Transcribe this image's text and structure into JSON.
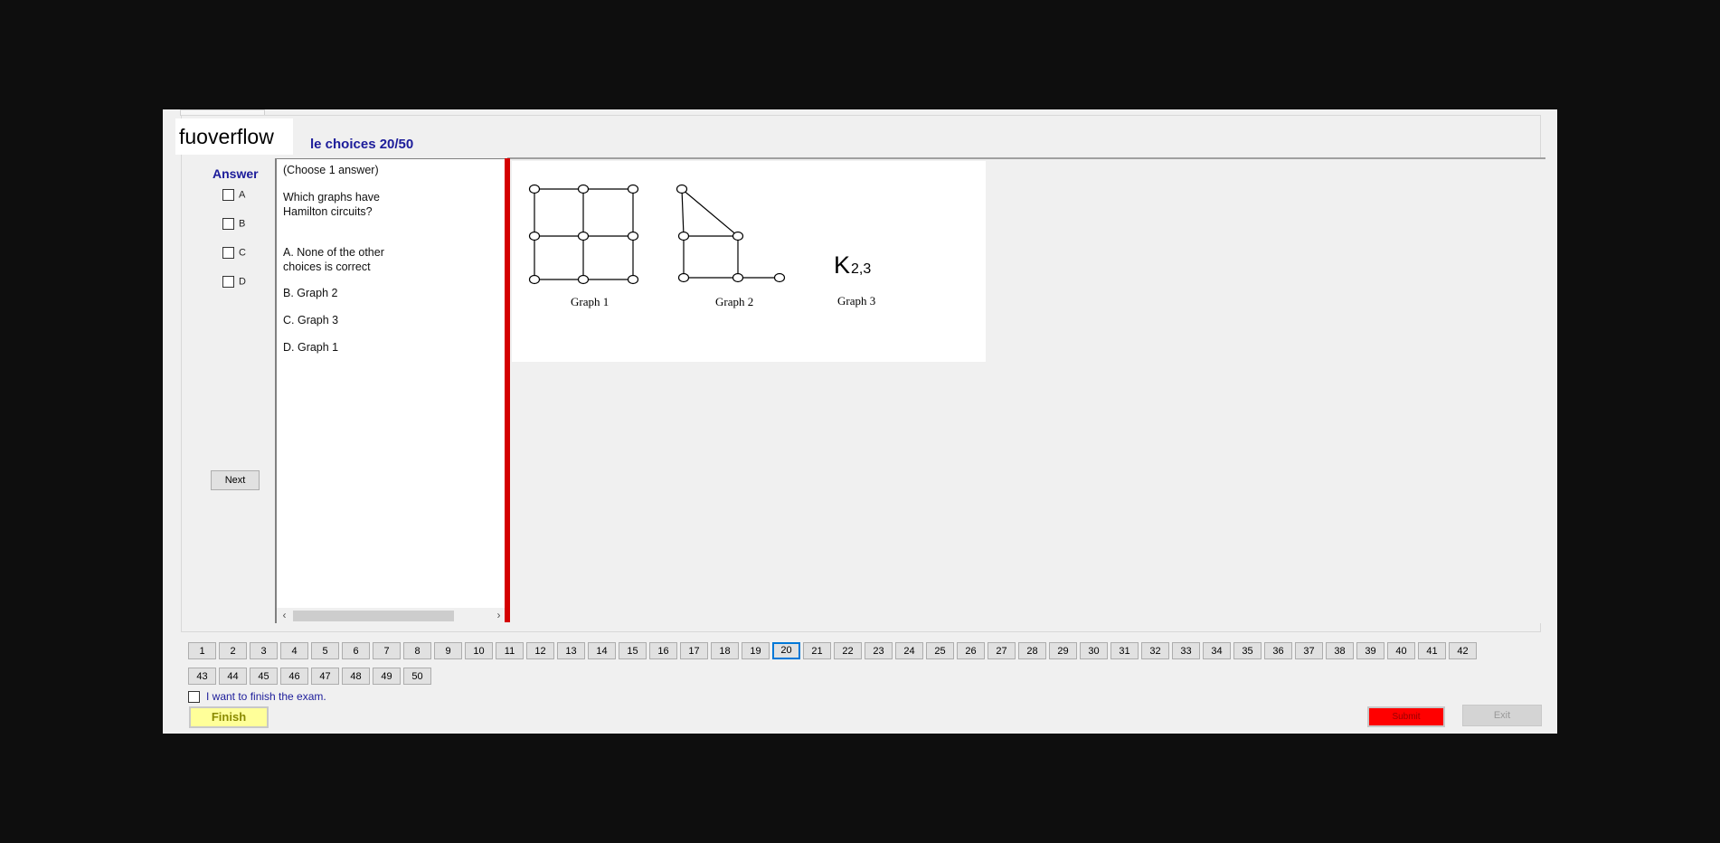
{
  "watermark": "fuoverflow",
  "section_title": "le choices 20/50",
  "answer": {
    "heading": "Answer",
    "options": [
      "A",
      "B",
      "C",
      "D"
    ],
    "next_label": "Next"
  },
  "question": {
    "instruction": "(Choose 1 answer)",
    "stem": "Which graphs have\nHamilton circuits?",
    "choices": [
      "A.  None of the other\nchoices is correct",
      "B.  Graph 2",
      "C.  Graph 3",
      "D.  Graph 1"
    ]
  },
  "figure": {
    "graph1_label": "Graph 1",
    "graph2_label": "Graph  2",
    "graph3_symbol": "K",
    "graph3_subscript": "2,3",
    "graph3_label": "Graph  3"
  },
  "navigation": {
    "current": "20",
    "row1": [
      "1",
      "2",
      "3",
      "4",
      "5",
      "6",
      "7",
      "8",
      "9",
      "10",
      "11",
      "12",
      "13",
      "14",
      "15",
      "16",
      "17",
      "18",
      "19",
      "20",
      "21",
      "22",
      "23",
      "24",
      "25",
      "26",
      "27",
      "28",
      "29",
      "30",
      "31",
      "32",
      "33",
      "34",
      "35",
      "36",
      "37",
      "38",
      "39",
      "40",
      "41",
      "42"
    ],
    "row2": [
      "43",
      "44",
      "45",
      "46",
      "47",
      "48",
      "49",
      "50"
    ]
  },
  "finish_checkbox_label": "I want to finish the exam.",
  "buttons": {
    "finish": "Finish",
    "submit": "Submit",
    "exit": "Exit"
  },
  "colors": {
    "title": "#1c1c9a",
    "splitter": "#d40000",
    "finish_bg": "#ffff99",
    "submit_bg": "#ff0000",
    "current_nav_border": "#0078d7"
  }
}
